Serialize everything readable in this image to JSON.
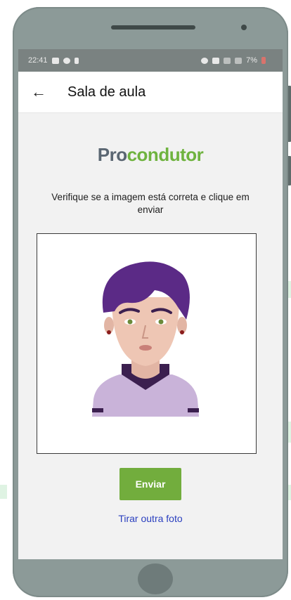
{
  "status_bar": {
    "time": "22:41",
    "battery": "7%"
  },
  "app_bar": {
    "title": "Sala de aula",
    "back_icon": "arrow-left-icon"
  },
  "logo": {
    "part1": "Pro",
    "part2": "condutor",
    "color_dark": "#5a6672",
    "color_green": "#6fb33f"
  },
  "instruction": "Verifique se a imagem está correta e clique em enviar",
  "photo": {
    "alt": "avatar"
  },
  "actions": {
    "send_label": "Enviar",
    "retake_label": "Tirar outra foto"
  },
  "colors": {
    "accent": "#72ad3d",
    "link": "#2a3fbf",
    "phone_body": "#8c9a98"
  }
}
